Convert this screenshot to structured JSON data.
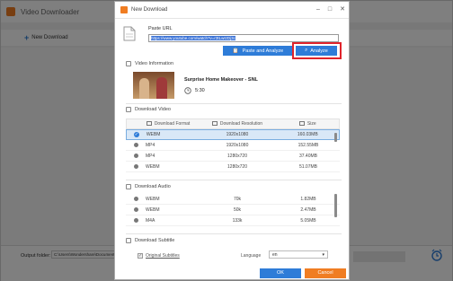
{
  "app": {
    "title": "Video Downloader",
    "new_download_label": "New Download",
    "output_folder_label": "Output folder:",
    "output_folder_path": "C:\\Users\\Wondershare\\Documents\\"
  },
  "dialog": {
    "title": "New Download",
    "paste_url_label": "Paste URL",
    "url_value": "https://www.youtube.com/watch?v=r3tLwIzDj3c",
    "paste_analyze_label": "Paste and Analyze",
    "analyze_label": "Analyze",
    "video_info_label": "Video Information",
    "video_title": "Surprise Home Makeover - SNL",
    "video_duration": "5:30",
    "download_video_label": "Download Video",
    "video_headers": {
      "format": "Download Format",
      "resolution": "Download Resolution",
      "size": "Size"
    },
    "video_rows": [
      {
        "format": "WEBM",
        "resolution": "1920x1080",
        "size": "160.03MB",
        "selected": true
      },
      {
        "format": "MP4",
        "resolution": "1920x1080",
        "size": "152.55MB",
        "selected": false
      },
      {
        "format": "MP4",
        "resolution": "1280x720",
        "size": "37.40MB",
        "selected": false
      },
      {
        "format": "WEBM",
        "resolution": "1280x720",
        "size": "51.07MB",
        "selected": false
      }
    ],
    "download_audio_label": "Download Audio",
    "audio_rows": [
      {
        "format": "WEBM",
        "bitrate": "70k",
        "size": "1.82MB"
      },
      {
        "format": "WEBM",
        "bitrate": "50k",
        "size": "2.47MB"
      },
      {
        "format": "M4A",
        "bitrate": "133k",
        "size": "5.05MB"
      }
    ],
    "download_subtitle_label": "Download Subtitle",
    "original_subtitles_label": "Original Subtitles",
    "language_label": "Language",
    "language_value": "en",
    "ok_label": "OK",
    "cancel_label": "Cancel"
  },
  "colors": {
    "accent": "#2e7cd8",
    "brand": "#f07d22",
    "highlight": "#e0232b"
  }
}
